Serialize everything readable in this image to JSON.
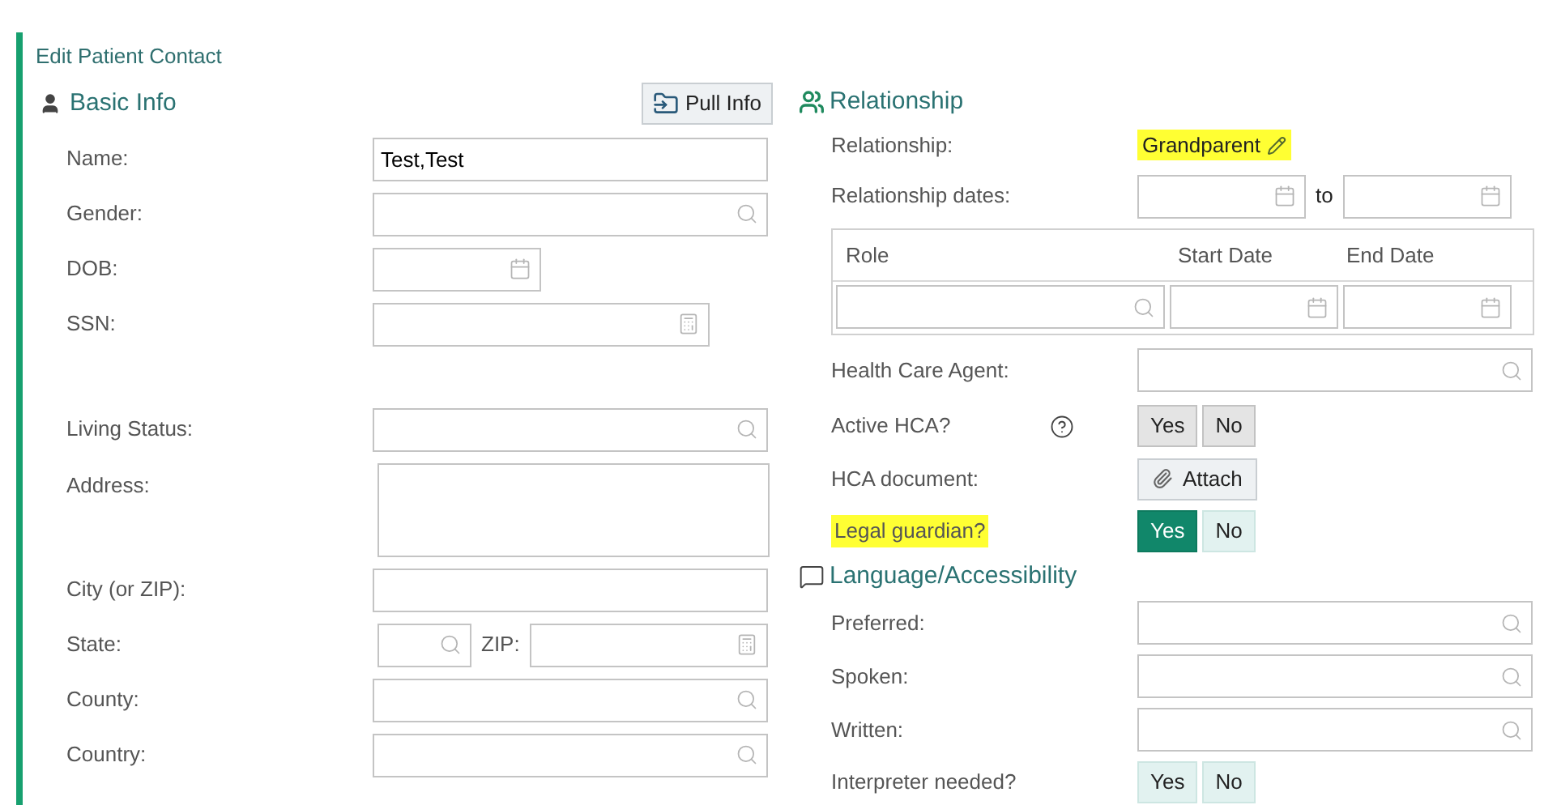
{
  "title": "Edit Patient Contact",
  "basic_info": {
    "heading": "Basic Info",
    "pull_button": "Pull Info",
    "groups": [
      [
        {
          "label": "Name:",
          "kind": "text",
          "value": "Test,Test"
        },
        {
          "label": "Gender:",
          "kind": "lookup"
        },
        {
          "label": "DOB:",
          "kind": "date"
        },
        {
          "label": "SSN:",
          "kind": "numeric"
        }
      ],
      [
        {
          "label": "Living Status:",
          "kind": "lookup"
        },
        {
          "label": "Address:",
          "kind": "textarea"
        },
        {
          "label": "City (or ZIP):",
          "kind": "text"
        },
        {
          "label": "State:",
          "kind": "state_zip",
          "zip_label": "ZIP:"
        },
        {
          "label": "County:",
          "kind": "lookup"
        },
        {
          "label": "Country:",
          "kind": "lookup"
        }
      ]
    ]
  },
  "relationship": {
    "heading": "Relationship",
    "relationship_label": "Relationship:",
    "relationship_value": "Grandparent",
    "value_highlighted": true,
    "dates_label": "Relationship dates:",
    "dates_separator": "to",
    "roles_table": {
      "columns": [
        "Role",
        "Start Date",
        "End Date"
      ]
    },
    "health_care_agent_label": "Health Care Agent:",
    "active_hca": {
      "label": "Active HCA?",
      "highlighted": false,
      "disabled": true,
      "options": [
        {
          "label": "Yes",
          "selected": false
        },
        {
          "label": "No",
          "selected": false
        }
      ]
    },
    "hca_document": {
      "label": "HCA document:",
      "button": "Attach"
    },
    "legal_guardian": {
      "label": "Legal guardian?",
      "highlighted": true,
      "disabled": false,
      "options": [
        {
          "label": "Yes",
          "selected": true
        },
        {
          "label": "No",
          "selected": false
        }
      ]
    }
  },
  "language": {
    "heading": "Language/Accessibility",
    "fields": [
      {
        "label": "Preferred:",
        "kind": "lookup"
      },
      {
        "label": "Spoken:",
        "kind": "lookup"
      },
      {
        "label": "Written:",
        "kind": "lookup"
      }
    ],
    "interpreter": {
      "label": "Interpreter needed?",
      "highlighted": false,
      "disabled": false,
      "options": [
        {
          "label": "Yes",
          "selected": false
        },
        {
          "label": "No",
          "selected": false
        }
      ]
    }
  }
}
